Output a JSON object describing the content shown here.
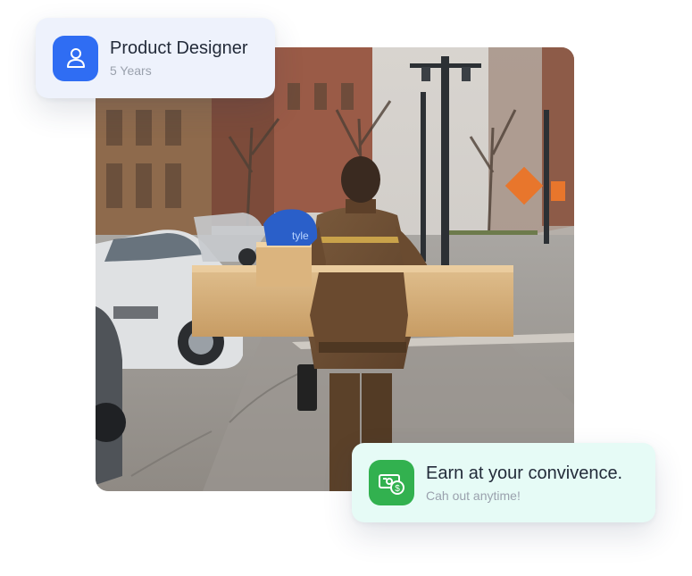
{
  "profile_card": {
    "title": "Product Designer",
    "subtitle": "5 Years",
    "icon": "user-icon",
    "accent": "#2f6df3"
  },
  "earn_card": {
    "title": "Earn at your convivence.",
    "subtitle": "Cah out anytime!",
    "icon": "cash-icon",
    "accent": "#32b14f"
  },
  "photo": {
    "subject": "delivery-person-carrying-boxes",
    "bag_text": "tyle"
  },
  "colors": {
    "profile_card_bg": "#eef2fc",
    "earn_card_bg": "#e6fbf6"
  }
}
